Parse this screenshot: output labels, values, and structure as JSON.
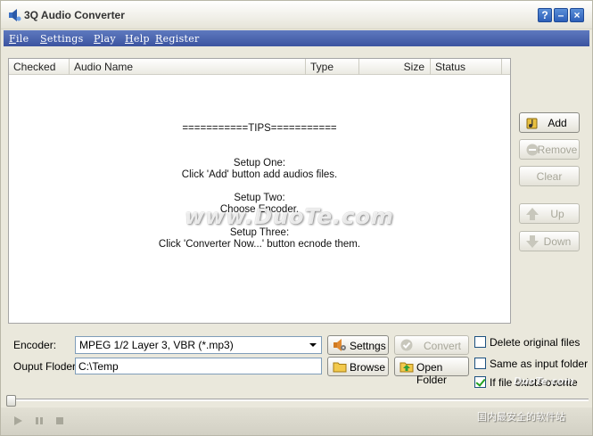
{
  "window": {
    "title": "3Q Audio Converter"
  },
  "title_buttons": {
    "help": "?",
    "minimize": "–",
    "close": "×"
  },
  "menu": [
    "File",
    "Settings",
    "Play",
    "Help",
    "Register"
  ],
  "table": {
    "columns": [
      "Checked",
      "Audio Name",
      "Type",
      "Size",
      "Status"
    ]
  },
  "tips": {
    "header": "===========TIPS===========",
    "step1_title": "Setup One:",
    "step1_text": "Click 'Add' button add audios files.",
    "step2_title": "Setup Two:",
    "step2_text": "Choose Encoder.",
    "step3_title": "Setup Three:",
    "step3_text": "Click 'Converter Now...' button ecnode them."
  },
  "watermark": "www.DuoTe.com",
  "side_buttons": {
    "add": "Add",
    "remove": "Remove",
    "clear": "Clear",
    "up": "Up",
    "down": "Down"
  },
  "form": {
    "encoder_label": "Encoder:",
    "encoder_value": "MPEG 1/2 Layer 3, VBR (*.mp3)",
    "output_label": "Ouput Floder:",
    "output_value": "C:\\Temp"
  },
  "buttons": {
    "settings": "Settngs",
    "convert": "Convert",
    "browse": "Browse",
    "open_folder": "Open Folder"
  },
  "checkboxes": {
    "delete_original": {
      "label": "Delete original files",
      "checked": false
    },
    "same_as_input": {
      "label": "Same as input folder",
      "checked": false
    },
    "if_exists_overwrite": {
      "label": "If file exists overite",
      "checked": true
    }
  },
  "corner_watermark": "国内最安全的软件站",
  "corner_watermark2": "DuoTe.com",
  "colors": {
    "menubar": "#4a63ad",
    "title_buttons": "#2d5fb8",
    "window_bg": "#eae8dc"
  }
}
